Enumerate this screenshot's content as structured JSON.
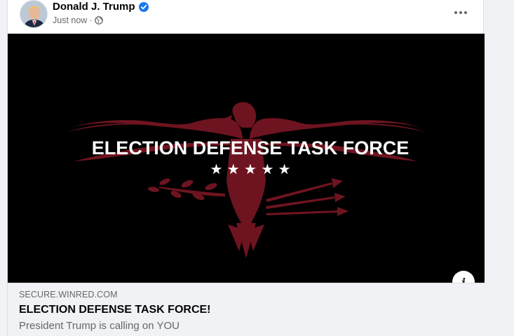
{
  "post": {
    "author": "Donald J. Trump",
    "timestamp": "Just now",
    "separator": "·",
    "privacy_icon": "globe-icon",
    "verified_icon": "verified-badge-icon",
    "menu_icon": "more-options-icon"
  },
  "image": {
    "headline": "ELECTION DEFENSE TASK FORCE",
    "stars": "★ ★ ★ ★ ★",
    "emblem": "eagle-emblem",
    "background_color": "#000000",
    "emblem_color": "#6e1420"
  },
  "link": {
    "domain": "SECURE.WINRED.COM",
    "title": "ELECTION DEFENSE TASK FORCE!",
    "description": "President Trump is calling on YOU",
    "info_label": "i"
  },
  "colors": {
    "verified_blue": "#1877f2",
    "secondary_text": "#65676b",
    "card_bg": "#f0f2f5"
  }
}
